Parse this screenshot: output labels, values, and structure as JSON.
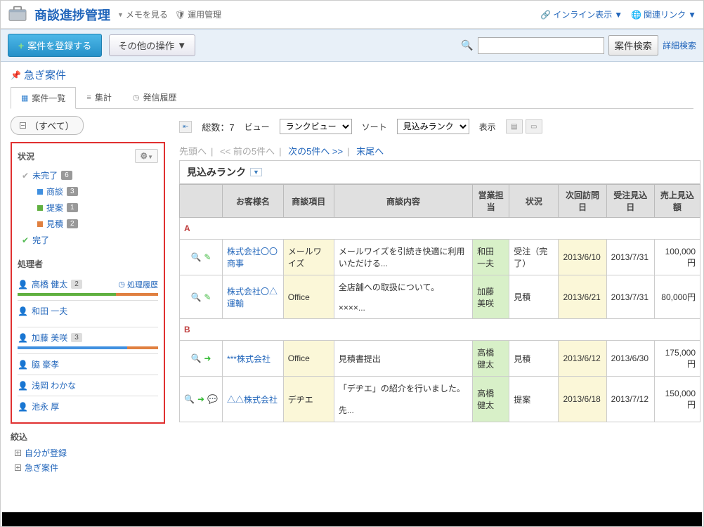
{
  "header": {
    "title": "商談進捗管理",
    "memo": "メモを見る",
    "admin": "運用管理",
    "inline": "インライン表示",
    "related": "関連リンク"
  },
  "toolbar": {
    "register": "案件を登録する",
    "other": "その他の操作",
    "search_btn": "案件検索",
    "detail_search": "詳細検索"
  },
  "urgent": "急ぎ案件",
  "tabs": {
    "list": "案件一覧",
    "agg": "集計",
    "history": "発信履歴"
  },
  "sidebar": {
    "all": "（すべて）",
    "status_head": "状況",
    "incomplete": "未完了",
    "incomplete_badge": "6",
    "negotiation": "商談",
    "negotiation_badge": "3",
    "proposal": "提案",
    "proposal_badge": "1",
    "estimate": "見積",
    "estimate_badge": "2",
    "complete": "完了",
    "handler_head": "処理者",
    "proc_history": "処理履歴",
    "users": [
      {
        "name": "高橋 健太",
        "badge": "2"
      },
      {
        "name": "和田 一夫"
      },
      {
        "name": "加藤 美咲",
        "badge": "3"
      },
      {
        "name": "脇 豪孝"
      },
      {
        "name": "浅岡 わかな"
      },
      {
        "name": "池永 厚"
      }
    ],
    "refine_head": "絞込",
    "refine1": "自分が登録",
    "refine2": "急ぎ案件"
  },
  "main": {
    "total_label": "総数：",
    "total_value": "7",
    "view_label": "ビュー",
    "view_select": "ランクビュー",
    "sort_label": "ソート",
    "sort_select": "見込みランク",
    "display_label": "表示",
    "pager_first": "先頭へ",
    "pager_prev": "<< 前の5件へ",
    "pager_next": "次の5件へ >>",
    "pager_last": "末尾へ",
    "rank_title": "見込みランク",
    "columns": [
      "",
      "お客様名",
      "商談項目",
      "商談内容",
      "営業担当",
      "状況",
      "次回訪問日",
      "受注見込日",
      "売上見込額"
    ],
    "rankA": "A",
    "rankB": "B",
    "rows": [
      {
        "customer": "株式会社〇〇商事",
        "item": "メールワイズ",
        "content": "メールワイズを引続き快適に利用いただける...",
        "rep": "和田 一夫",
        "status": "受注（完了）",
        "visit": "2013/6/10",
        "order": "2013/7/31",
        "amount": "100,000円"
      },
      {
        "customer": "株式会社〇△運輸",
        "item": "Office",
        "content": "全店舗への取扱について。\n\n××××...",
        "rep": "加藤 美咲",
        "status": "見積",
        "visit": "2013/6/21",
        "order": "2013/7/31",
        "amount": "80,000円"
      },
      {
        "customer": "***株式会社",
        "item": "Office",
        "content": "見積書提出",
        "rep": "高橋 健太",
        "status": "見積",
        "visit": "2013/6/12",
        "order": "2013/6/30",
        "amount": "175,000円"
      },
      {
        "customer": "△△株式会社",
        "item": "デヂエ",
        "content": "「デヂエ」の紹介を行いました。\n\n先...",
        "rep": "高橋 健太",
        "status": "提案",
        "visit": "2013/6/18",
        "order": "2013/7/12",
        "amount": "150,000円"
      }
    ]
  }
}
